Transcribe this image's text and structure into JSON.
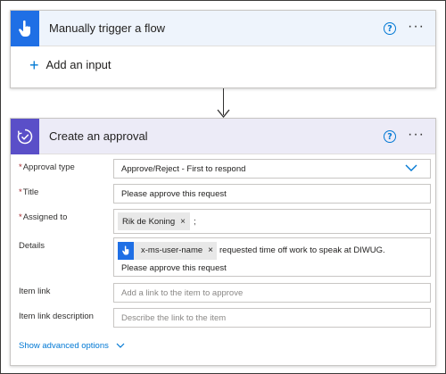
{
  "trigger": {
    "title": "Manually trigger a flow",
    "help_icon": "?",
    "more_icon": "···",
    "add_input_label": "Add an input",
    "accent_color": "#1f6fe5"
  },
  "approval": {
    "title": "Create an approval",
    "help_icon": "?",
    "more_icon": "···",
    "accent_color": "#5a4fc8",
    "fields": {
      "approval_type": {
        "label": "Approval type",
        "required": true,
        "value": "Approve/Reject - First to respond"
      },
      "title": {
        "label": "Title",
        "required": true,
        "value": "Please approve this request"
      },
      "assigned_to": {
        "label": "Assigned to",
        "required": true,
        "token": "Rik de Koning",
        "trailing": ";"
      },
      "details": {
        "label": "Details",
        "dynamic_token": "x-ms-user-name",
        "line1": "requested time off work to speak at DIWUG.",
        "line2": "Please approve this request"
      },
      "item_link": {
        "label": "Item link",
        "placeholder": "Add a link to the item to approve"
      },
      "item_link_description": {
        "label": "Item link description",
        "placeholder": "Describe the link to the item"
      }
    },
    "show_advanced_label": "Show advanced options",
    "required_marker": "*"
  }
}
